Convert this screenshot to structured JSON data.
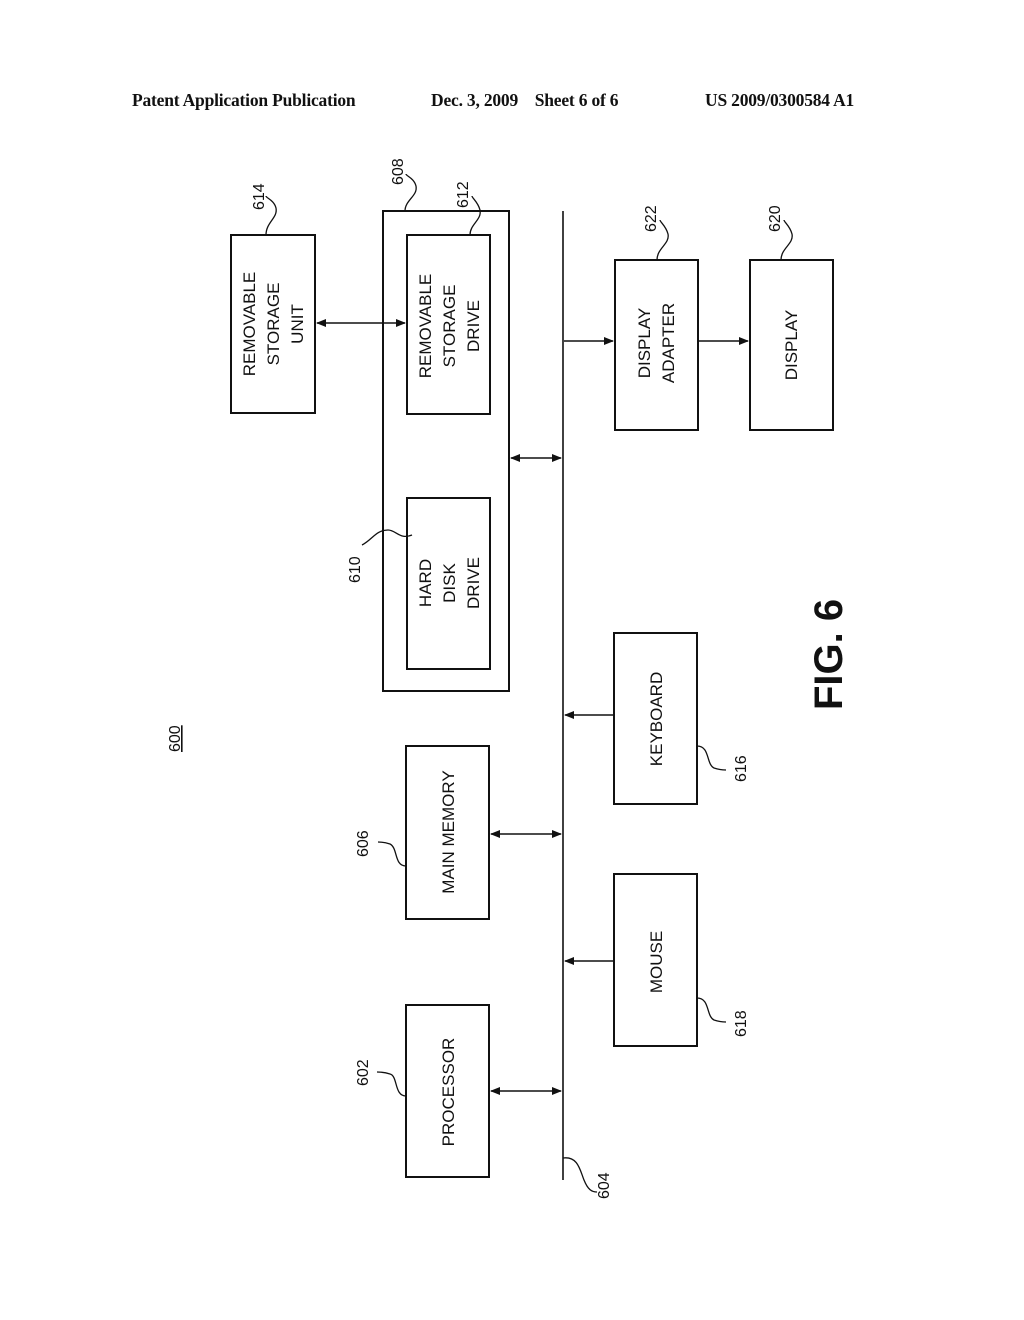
{
  "header": {
    "publication": "Patent Application Publication",
    "date_sheet": "Dec. 3, 2009    Sheet 6 of 6",
    "number": "US 2009/0300584 A1"
  },
  "figure": {
    "label": "FIG. 6",
    "system_ref": "600",
    "bus_ref": "604"
  },
  "blocks": {
    "processor": {
      "ref": "602",
      "lines": [
        "PROCESSOR"
      ]
    },
    "main_memory": {
      "ref": "606",
      "lines": [
        "MAIN MEMORY"
      ]
    },
    "secondary_memory": {
      "ref": "608"
    },
    "hard_disk_drive": {
      "ref": "610",
      "lines": [
        "HARD",
        "DISK",
        "DRIVE"
      ]
    },
    "removable_storage_drive": {
      "ref": "612",
      "lines": [
        "REMOVABLE",
        "STORAGE",
        "DRIVE"
      ]
    },
    "removable_storage_unit": {
      "ref": "614",
      "lines": [
        "REMOVABLE",
        "STORAGE",
        "UNIT"
      ]
    },
    "keyboard": {
      "ref": "616",
      "lines": [
        "KEYBOARD"
      ]
    },
    "mouse": {
      "ref": "618",
      "lines": [
        "MOUSE"
      ]
    },
    "display": {
      "ref": "620",
      "lines": [
        "DISPLAY"
      ]
    },
    "display_adapter": {
      "ref": "622",
      "lines": [
        "DISPLAY",
        "ADAPTER"
      ]
    }
  },
  "connections": [
    {
      "from": "processor",
      "to": "bus",
      "direction": "bidirectional"
    },
    {
      "from": "main_memory",
      "to": "bus",
      "direction": "bidirectional"
    },
    {
      "from": "secondary_memory",
      "to": "bus",
      "direction": "bidirectional"
    },
    {
      "from": "removable_storage_unit",
      "to": "removable_storage_drive",
      "direction": "bidirectional"
    },
    {
      "from": "keyboard",
      "to": "bus",
      "direction": "unidirectional"
    },
    {
      "from": "mouse",
      "to": "bus",
      "direction": "unidirectional"
    },
    {
      "from": "bus",
      "to": "display_adapter",
      "direction": "unidirectional"
    },
    {
      "from": "display_adapter",
      "to": "display",
      "direction": "unidirectional"
    }
  ]
}
